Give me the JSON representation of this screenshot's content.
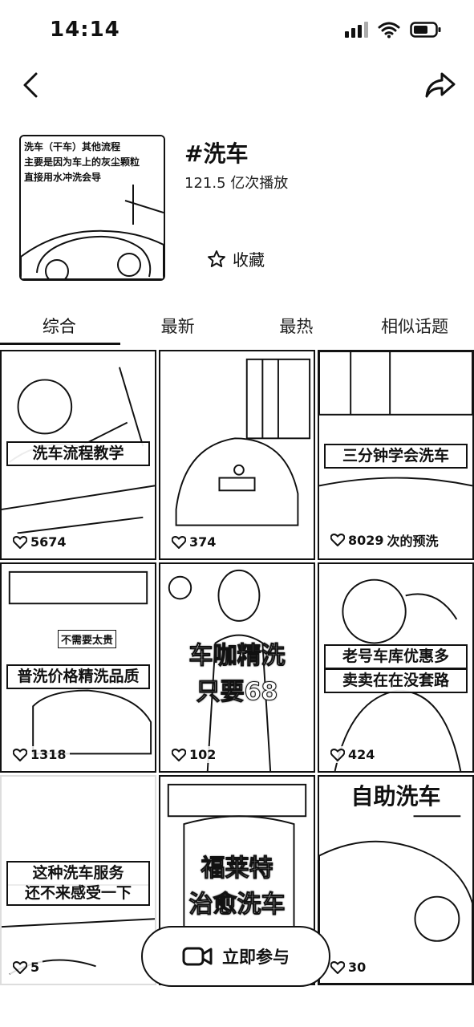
{
  "status_bar": {
    "time": "14:14"
  },
  "topic": {
    "title": "#洗车",
    "plays": "121.5 亿次播放",
    "favorite_label": "收藏",
    "cover_text": [
      "洗车（干车）其他流程",
      "主要是因为车上的灰尘颗粒",
      "直接用水冲洗会导"
    ]
  },
  "tabs": [
    {
      "label": "综合",
      "active": true
    },
    {
      "label": "最新",
      "active": false
    },
    {
      "label": "最热",
      "active": false
    },
    {
      "label": "相似话题",
      "active": false
    }
  ],
  "videos": [
    {
      "caption": "洗车流程教学",
      "likes": "5674"
    },
    {
      "caption": "",
      "likes": "374"
    },
    {
      "caption": "三分钟学会洗车",
      "likes": "8029",
      "sub": "次的预洗"
    },
    {
      "caption": "普洗价格精洗品质",
      "likes": "1318",
      "sub": "不需要太贵"
    },
    {
      "caption": "车咖精洗",
      "caption2": "只要68",
      "likes": "102"
    },
    {
      "caption": "老号车库优惠多",
      "caption2": "卖卖在在没套路",
      "likes": "424"
    },
    {
      "caption": "这种洗车服务",
      "caption2": "还不来感受一下",
      "likes": "5"
    },
    {
      "caption": "福莱特",
      "caption2": "治愈洗车",
      "likes": ""
    },
    {
      "caption": "自助洗车",
      "likes": "30"
    }
  ],
  "join_button": {
    "label": "立即参与"
  },
  "colors": {
    "text": "#111111",
    "background": "#ffffff"
  }
}
